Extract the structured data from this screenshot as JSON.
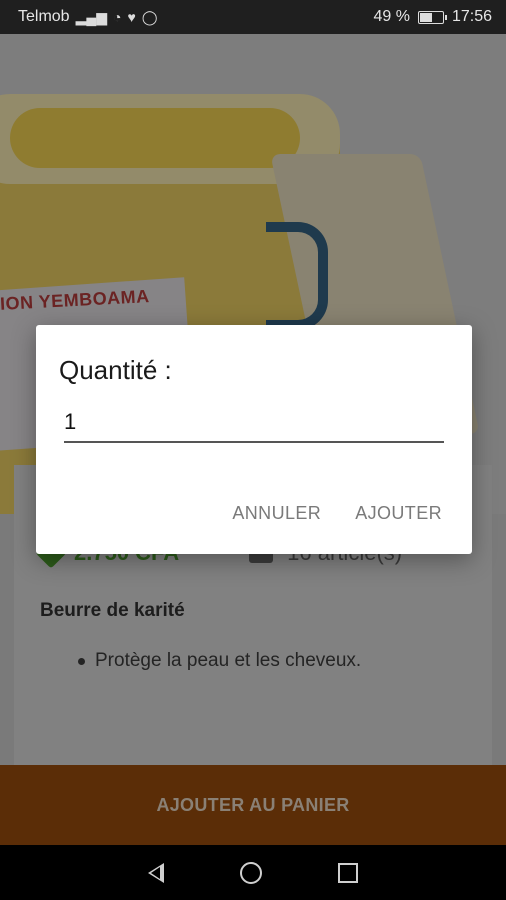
{
  "status_bar": {
    "carrier": "Telmob",
    "battery_percent": "49 %",
    "time": "17:56",
    "icons": [
      "signal-icon",
      "wifi-icon",
      "heart-icon",
      "whatsapp-icon",
      "battery-icon"
    ]
  },
  "hero": {
    "label_text": "ION YEMBOAMA"
  },
  "product": {
    "price": "2.750 CFA",
    "stock": "16 article(s)",
    "name": "Beurre de karité",
    "bullets": [
      "Protège la peau et les cheveux."
    ]
  },
  "cart_button": {
    "label": "AJOUTER AU PANIER"
  },
  "dialog": {
    "title": "Quantité :",
    "input_value": "1",
    "cancel_label": "ANNULER",
    "confirm_label": "AJOUTER"
  },
  "colors": {
    "accent": "#b85a0e",
    "price_green": "#2e8b1e",
    "scrim": "rgba(0,0,0,0.5)"
  }
}
